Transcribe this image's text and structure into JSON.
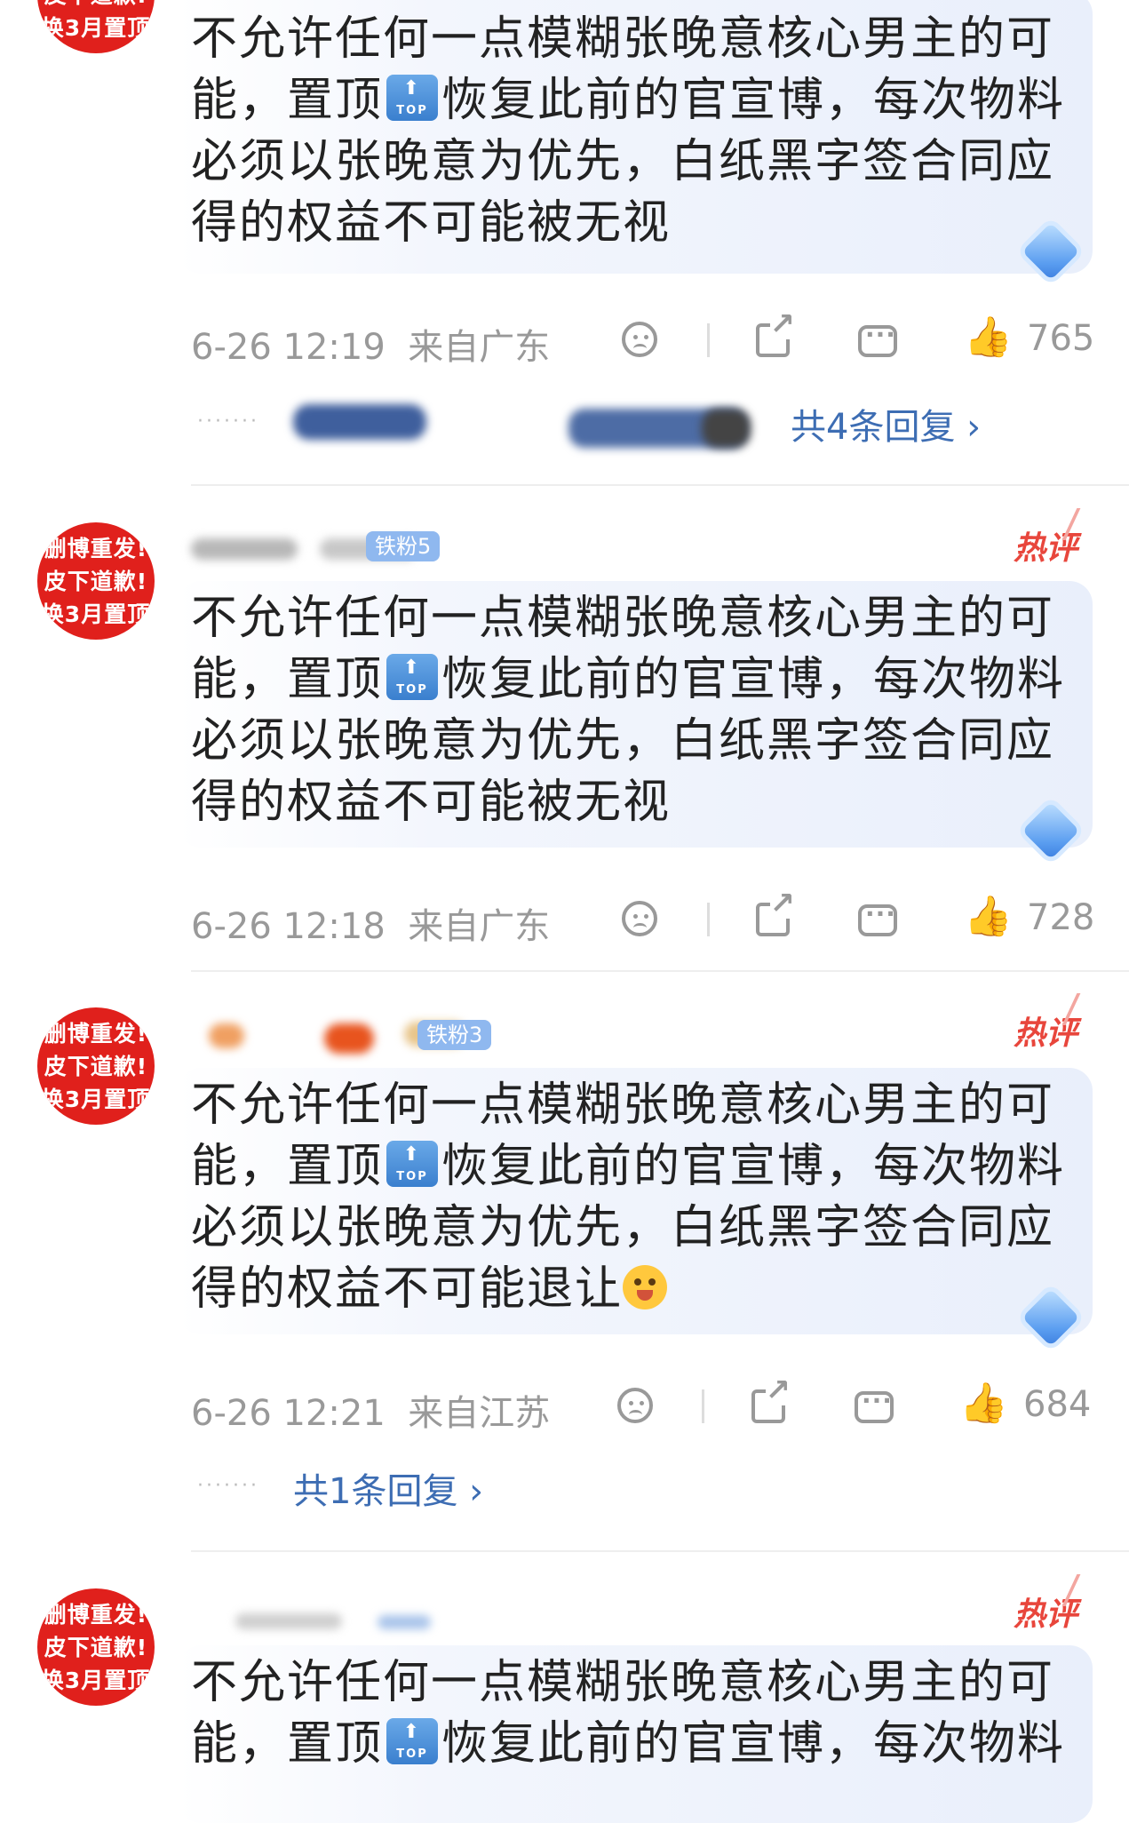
{
  "avatar_lines": [
    "删博重发!",
    "皮下道歉!",
    "换3月置顶"
  ],
  "hot_label": "热评",
  "top_badge": {
    "arrow": "⬆",
    "label": "TOP"
  },
  "comments": [
    {
      "line1": "不允许任何一点模糊张晚意核心男主的可",
      "line2_a": "能，置顶",
      "line2_b": "恢复此前的官宣博，每次物料",
      "line3": "必须以张晚意为优先，白纸黑字签合同应",
      "line4": "得的权益不可能被无视",
      "time": "6-26 12:19",
      "location": "来自广东",
      "likes": "765",
      "replies": "共4条回复",
      "user_badge": ""
    },
    {
      "line1": "不允许任何一点模糊张晚意核心男主的可",
      "line2_a": "能，置顶",
      "line2_b": "恢复此前的官宣博，每次物料",
      "line3": "必须以张晚意为优先，白纸黑字签合同应",
      "line4": "得的权益不可能被无视",
      "time": "6-26 12:18",
      "location": "来自广东",
      "likes": "728",
      "user_badge": "铁粉5"
    },
    {
      "line1": "不允许任何一点模糊张晚意核心男主的可",
      "line2_a": "能，置顶",
      "line2_b": "恢复此前的官宣博，每次物料",
      "line3": "必须以张晚意为优先，白纸黑字签合同应",
      "line4": "得的权益不可能退让",
      "time": "6-26 12:21",
      "location": "来自江苏",
      "likes": "684",
      "replies": "共1条回复",
      "user_badge": "铁粉3"
    },
    {
      "line1": "不允许任何一点模糊张晚意核心男主的可",
      "line2_a": "能，置顶",
      "line2_b": "恢复此前的官宣博，每次物料"
    }
  ],
  "colors": {
    "avatar": "#e0201c",
    "reply_link": "#3d6db3",
    "hot": "#e8463c",
    "meta": "#999999"
  },
  "icons": [
    "sad-face-icon",
    "share-icon",
    "comment-icon",
    "thumbs-up-icon",
    "diamond-icon",
    "chevron-right-icon",
    "top-badge-icon"
  ]
}
